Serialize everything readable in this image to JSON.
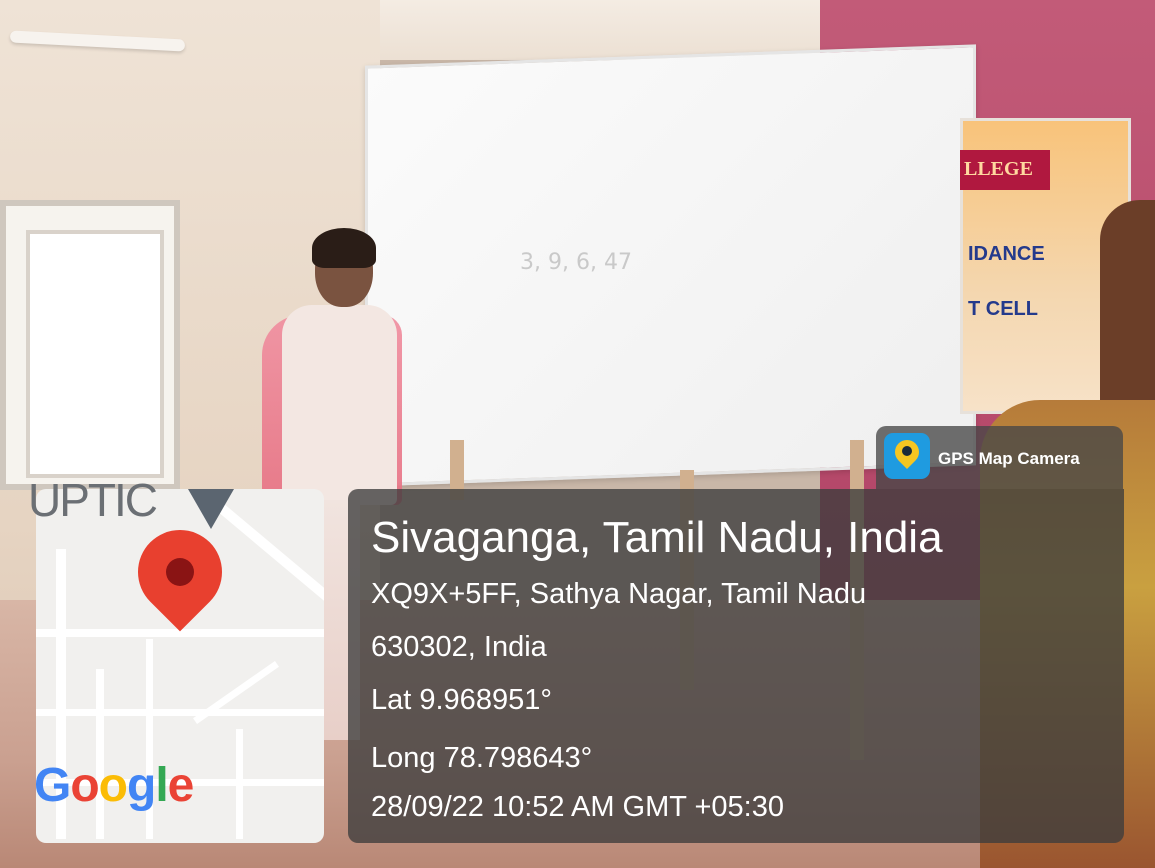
{
  "photo": {
    "board_text": "3, 9, 6, 47",
    "banner": {
      "logo_text": "LLEGE",
      "line1": "IDANCE",
      "line2": "T CELL"
    }
  },
  "overlay": {
    "map": {
      "street_label": "UPTIC",
      "logo": [
        "G",
        "o",
        "o",
        "g",
        "l",
        "e"
      ],
      "logo_colors": [
        "#4285F4",
        "#EA4335",
        "#FBBC05",
        "#4285F4",
        "#34A853",
        "#EA4335"
      ]
    },
    "badge": {
      "label": "GPS Map Camera",
      "icon": "gps-camera-icon"
    },
    "location": {
      "title": "Sivaganga, Tamil Nadu, India",
      "address_line1": "XQ9X+5FF, Sathya Nagar, Tamil Nadu",
      "address_line2": "630302, India",
      "latitude": "Lat 9.968951°",
      "longitude": "Long 78.798643°",
      "timestamp": "28/09/22 10:52 AM GMT +05:30"
    }
  }
}
